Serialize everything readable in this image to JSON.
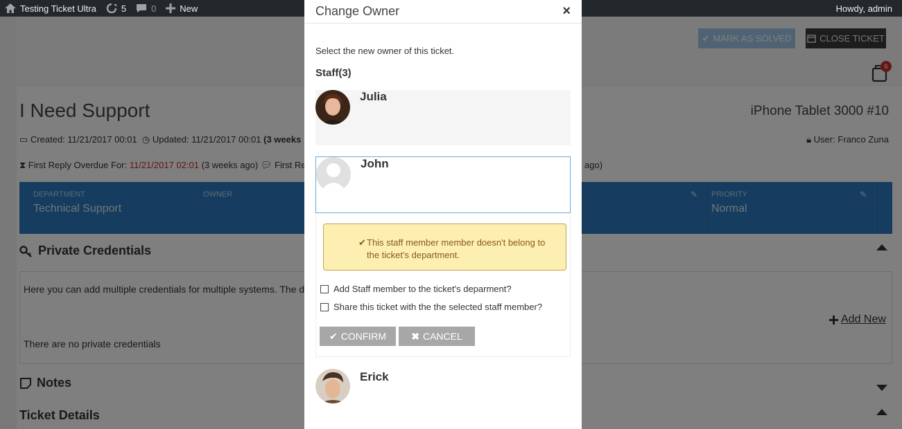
{
  "adminbar": {
    "site_name": "Testing Ticket Ultra",
    "updates_count": "5",
    "comments_count": "0",
    "new_label": "New",
    "howdy": "Howdy, admin"
  },
  "ticket": {
    "mark_solved_label": "MARK AS SOLVED",
    "close_ticket_label": "CLOSE TICKET",
    "notification_count": "6",
    "title": "I Need Support",
    "product": "iPhone Tablet 3000 #10",
    "created_label": "Created:",
    "created_value": "11/21/2017 00:01",
    "updated_label": "Updated:",
    "updated_value": "11/21/2017 00:01",
    "updated_ago": "(3 weeks",
    "user_label": "User:",
    "user_value": "Franco Zuna",
    "first_reply_label": "First Reply Overdue For:",
    "first_reply_value": "11/21/2017 02:01",
    "first_reply_ago": "(3 weeks ago)",
    "first_reply_next": "First Rep",
    "right_ago": "ago)",
    "department_label": "DEPARTMENT",
    "department_value": "Technical Support",
    "owner_label": "OWNER",
    "priority_label": "PRIORITY",
    "priority_value": "Normal",
    "private_credentials_title": "Private Credentials",
    "credentials_text": "Here you can add multiple credentials for multiple systems. The da",
    "add_new_label": "Add New",
    "no_credentials": "There are no private credentials",
    "notes_title": "Notes",
    "ticket_details_title": "Ticket Details"
  },
  "modal": {
    "title": "Change Owner",
    "close_glyph": "×",
    "intro": "Select the new owner of this ticket.",
    "staff_count": "Staff(3)",
    "staff": [
      {
        "name": "Julia"
      },
      {
        "name": "John"
      },
      {
        "name": "Erick"
      }
    ],
    "warning": "This staff member member doesn't belong to the ticket's department.",
    "checkbox_add": "Add Staff member to the ticket's deparment?",
    "checkbox_share": "Share this ticket with the the selected staff member?",
    "confirm_label": "CONFIRM",
    "cancel_label": "CANCEL"
  },
  "colors": {
    "department_bar": "#2d7bbf",
    "warning_bg": "#fdeeb2",
    "selected_border": "#6aa9d6"
  }
}
